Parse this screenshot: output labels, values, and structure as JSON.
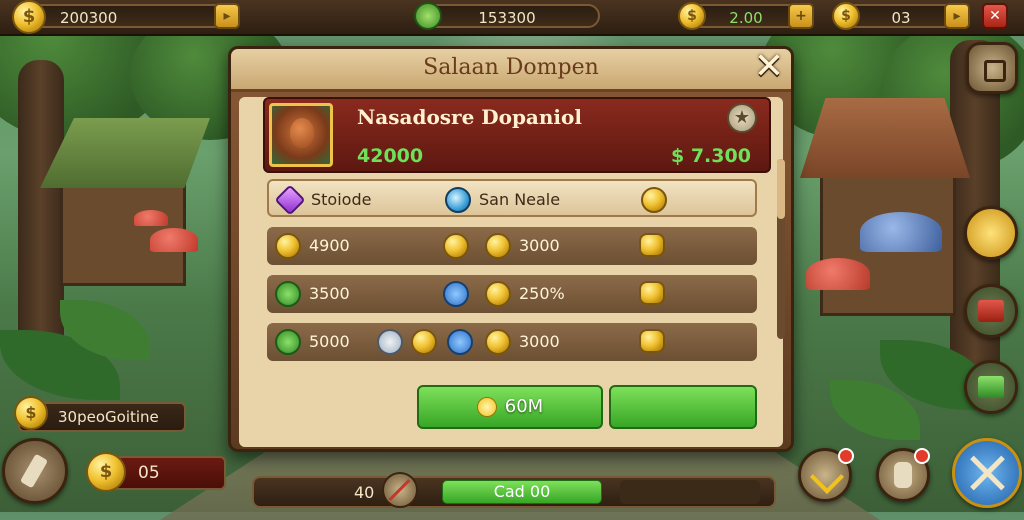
{
  "topbar": {
    "gold_value": "200300",
    "gem_value": "153300",
    "coins_value": "2.00",
    "count_value": "03"
  },
  "dialog": {
    "title": "Salaan Dompen",
    "name": "Nasadosre Dopaniol",
    "left_value": "42000",
    "right_value": "$ 7.300",
    "rows": [
      {
        "label_a": "Stoiode",
        "label_b": "San Neale"
      },
      {
        "label_a": "4900",
        "label_b": "3000"
      },
      {
        "label_a": "3500",
        "label_b": "250%"
      },
      {
        "label_a": "5000",
        "label_b": "3000"
      }
    ],
    "confirm_label": "60M"
  },
  "left_panel": {
    "status_label": "30peoGoitine",
    "counter_value": "05"
  },
  "bottom": {
    "left_value": "40",
    "button_label": "Cad 00"
  }
}
